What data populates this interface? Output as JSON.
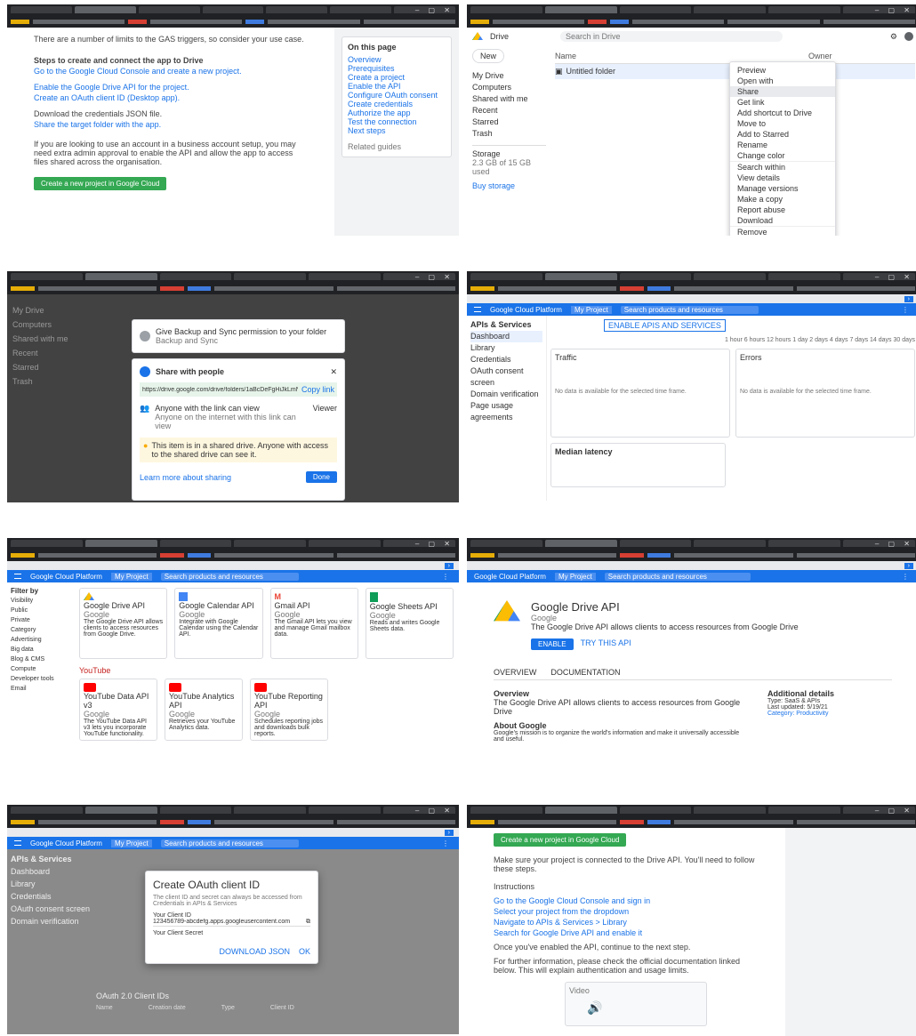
{
  "tile1": {
    "intro": "There are a number of limits to the GAS triggers, so consider your use case.",
    "section_label": "Steps to create and connect the app to Drive",
    "steps": [
      "Go to the Google Cloud Console and create a new project.",
      "Enable the Google Drive API for the project.",
      "Create an OAuth client ID (Desktop app).",
      "Download the credentials JSON file.",
      "Share the target folder with the app."
    ],
    "paragraph": "If you are looking to use an account in a business account setup, you may need extra admin approval to enable the API and allow the app to access files shared across the organisation.",
    "button": "Create a new project in Google Cloud",
    "sidebar_title": "On this page",
    "sidebar_items": [
      "Overview",
      "Prerequisites",
      "Create a project",
      "Enable the API",
      "Configure OAuth consent",
      "Create credentials",
      "Authorize the app",
      "Test the connection",
      "Next steps"
    ],
    "sidebar_footer": "Related guides"
  },
  "tile2": {
    "app_name": "Drive",
    "new_button": "New",
    "search_placeholder": "Search in Drive",
    "nav": [
      "My Drive",
      "Computers",
      "Shared with me",
      "Recent",
      "Starred",
      "Trash"
    ],
    "storage_label": "Storage",
    "storage_text": "2.3 GB of 15 GB used",
    "buy_storage": "Buy storage",
    "column_name": "Name",
    "column_owner": "Owner",
    "file_name": "Untitled folder",
    "menu": [
      "Preview",
      "Open with",
      "Share",
      "Get link",
      "Add shortcut to Drive",
      "Move to",
      "Add to Starred",
      "Rename",
      "Change color",
      "Search within",
      "View details",
      "Manage versions",
      "Make a copy",
      "Report abuse",
      "Download",
      "Remove"
    ]
  },
  "tile3": {
    "sync_title": "Give Backup and Sync permission to your folder",
    "sync_sub": "Backup and Sync",
    "share_title": "Share with people",
    "share_link": "https://drive.google.com/drive/folders/1aBcDeFgHiJkLmNoPqRs",
    "copy_link": "Copy link",
    "people_label": "Anyone with the link can view",
    "people_sub": "Anyone on the internet with this link can view",
    "role": "Viewer",
    "warning": "This item is in a shared drive. Anyone with access to the shared drive can see it.",
    "done_button": "Done",
    "learn_more": "Learn more about sharing"
  },
  "tile4": {
    "brand": "Google Cloud Platform",
    "project": "My Project",
    "search": "Search products and resources",
    "side_title": "APIs & Services",
    "side_items": [
      "Dashboard",
      "Library",
      "Credentials",
      "OAuth consent screen",
      "Domain verification",
      "Page usage agreements"
    ],
    "tab_enable": "ENABLE APIS AND SERVICES",
    "filter": "1 hour  6 hours  12 hours  1 day  2 days  4 days  7 days  14 days  30 days",
    "chart_traffic": "Traffic",
    "chart_errors": "Errors",
    "chart_latency": "Median latency",
    "no_data": "No data is available for the selected time frame."
  },
  "tile5": {
    "heading": "Filter by",
    "filters": [
      "Visibility",
      "Public",
      "Private",
      "Category",
      "Advertising",
      "Big data",
      "Blog & CMS",
      "Compute",
      "Developer tools",
      "Email"
    ],
    "section_label": "YouTube",
    "apis": [
      {
        "name": "Google Drive API",
        "vendor": "Google",
        "desc": "The Google Drive API allows clients to access resources from Google Drive."
      },
      {
        "name": "Google Calendar API",
        "vendor": "Google",
        "desc": "Integrate with Google Calendar using the Calendar API."
      },
      {
        "name": "Gmail API",
        "vendor": "Google",
        "desc": "The Gmail API lets you view and manage Gmail mailbox data."
      },
      {
        "name": "Google Sheets API",
        "vendor": "Google",
        "desc": "Reads and writes Google Sheets data."
      },
      {
        "name": "YouTube Data API v3",
        "vendor": "Google",
        "desc": "The YouTube Data API v3 lets you incorporate YouTube functionality."
      },
      {
        "name": "YouTube Analytics API",
        "vendor": "Google",
        "desc": "Retrieves your YouTube Analytics data."
      },
      {
        "name": "YouTube Reporting API",
        "vendor": "Google",
        "desc": "Schedules reporting jobs and downloads bulk reports."
      }
    ]
  },
  "tile6": {
    "api_title": "Google Drive API",
    "api_vendor": "Google",
    "api_desc": "The Google Drive API allows clients to access resources from Google Drive",
    "enable_button": "ENABLE",
    "try_button": "TRY THIS API",
    "tab_overview": "OVERVIEW",
    "tab_docs": "DOCUMENTATION",
    "overview_title": "Overview",
    "overview_text": "The Google Drive API allows clients to access resources from Google Drive",
    "about_title": "About Google",
    "about_text": "Google's mission is to organize the world's information and make it universally accessible and useful.",
    "more_title": "Additional details",
    "more_items": [
      "Type: SaaS & APIs",
      "Last updated: 5/19/21",
      "Category: Productivity"
    ]
  },
  "tile7": {
    "side_title": "APIs & Services",
    "side_items": [
      "Dashboard",
      "Library",
      "Credentials",
      "OAuth consent screen",
      "Domain verification"
    ],
    "dialog_title": "Create OAuth client ID",
    "dialog_text": "The client ID and secret can always be accessed from Credentials in APIs & Services",
    "client_label": "Your Client ID",
    "client_value": "123456789-abcdefg.apps.googleusercontent.com",
    "secret_label": "Your Client Secret",
    "download_json": "DOWNLOAD JSON",
    "ok_button": "OK",
    "table_title": "OAuth 2.0 Client IDs",
    "col_name": "Name",
    "col_created": "Creation date",
    "col_type": "Type",
    "col_client": "Client ID"
  },
  "tile8": {
    "top_button": "Create a new project in Google Cloud",
    "paragraph": "Make sure your project is connected to the Drive API. You'll need to follow these steps.",
    "list_label": "Instructions",
    "links": [
      "Go to the Google Cloud Console and sign in",
      "Select your project from the dropdown",
      "Navigate to APIs & Services > Library",
      "Search for Google Drive API and enable it"
    ],
    "note": "Once you've enabled the API, continue to the next step.",
    "paragraph2": "For further information, please check the official documentation linked below. This will explain authentication and usage limits.",
    "video_label": "Video"
  }
}
